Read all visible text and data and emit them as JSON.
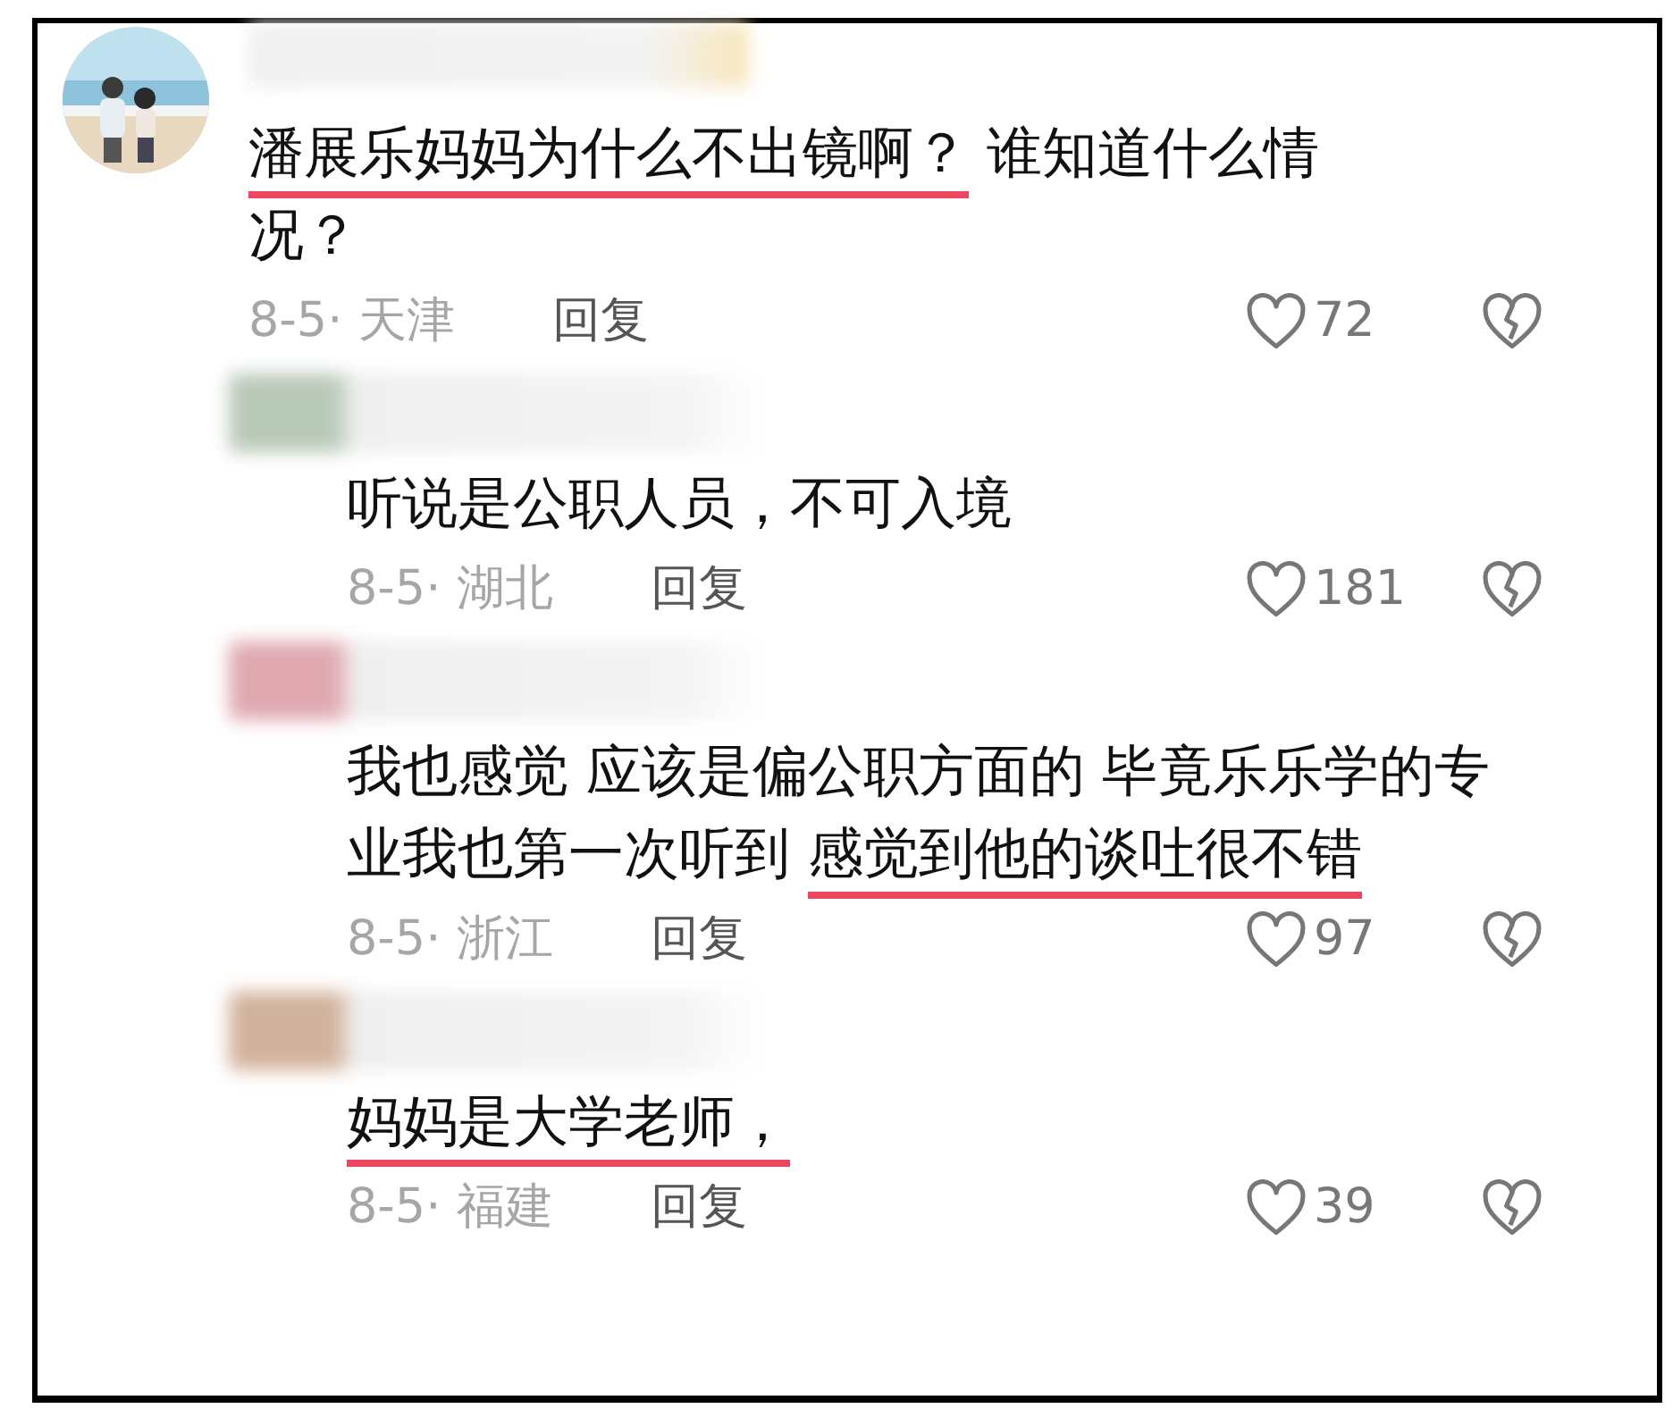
{
  "comments": [
    {
      "kind": "top",
      "segments": [
        {
          "text": "潘展乐妈妈为什么不出镜啊？",
          "underlined": true
        },
        {
          "text": "  谁知道什么情况？",
          "underlined": false
        }
      ],
      "date": "8-5· 天津",
      "reply": "回复",
      "likes": "72"
    },
    {
      "kind": "reply",
      "color": "#b9c9b8",
      "segments": [
        {
          "text": "听说是公职人员，不可入境",
          "underlined": false
        }
      ],
      "date": "8-5· 湖北",
      "reply": "回复",
      "likes": "181"
    },
    {
      "kind": "reply",
      "color": "#e0a8b0",
      "segments": [
        {
          "text": "我也感觉 应该是偏公职方面的 毕竟乐乐学的专业我也第一次听到 ",
          "underlined": false
        },
        {
          "text": "感觉到他的谈吐很不错",
          "underlined": true
        }
      ],
      "date": "8-5· 浙江",
      "reply": "回复",
      "likes": "97"
    },
    {
      "kind": "reply",
      "color": "#d2b29c",
      "segments": [
        {
          "text": "妈妈是大学老师，",
          "underlined": true
        }
      ],
      "date": "8-5· 福建",
      "reply": "回复",
      "likes": "39"
    }
  ]
}
